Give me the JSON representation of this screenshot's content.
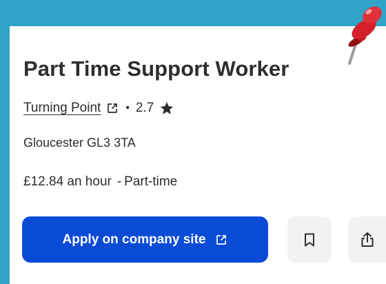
{
  "job": {
    "title": "Part Time Support Worker",
    "company": "Turning Point",
    "separator": "•",
    "rating": "2.7",
    "location": "Gloucester GL3 3TA",
    "salary": "£12.84 an hour",
    "salary_separator": "-",
    "job_type": "Part-time"
  },
  "actions": {
    "apply_label": "Apply on company site",
    "save_icon": "bookmark-icon",
    "share_icon": "share-icon"
  },
  "colors": {
    "background": "#2fa4c6",
    "apply_button": "#0a4bd6",
    "icon_button_bg": "#f3f2f1",
    "pushpin": "#d3202a"
  }
}
